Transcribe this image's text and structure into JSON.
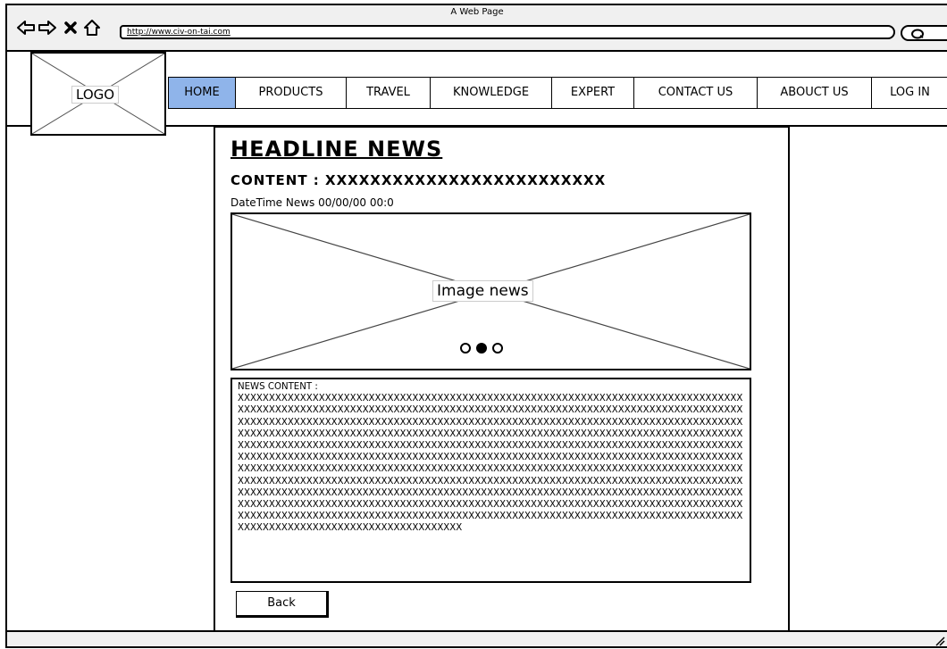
{
  "window": {
    "title": "A Web Page",
    "url": "http://www.civ-on-tai.com"
  },
  "header": {
    "logo_label": "LOGO",
    "nav": [
      {
        "label": "HOME",
        "active": true
      },
      {
        "label": "PRODUCTS"
      },
      {
        "label": "TRAVEL"
      },
      {
        "label": "KNOWLEDGE"
      },
      {
        "label": "EXPERT"
      },
      {
        "label": "CONTACT US"
      },
      {
        "label": "ABOUCT US"
      },
      {
        "label": "LOG IN"
      }
    ]
  },
  "article": {
    "headline": "HEADLINE NEWS",
    "content": "CONTENT : XXXXXXXXXXXXXXXXXXXXXXXXX",
    "datetime": "DateTime News  00/00/00  00:0",
    "image_label": "Image news",
    "carousel_dots": 3,
    "carousel_active": 1,
    "news_label": "NEWS CONTENT :",
    "news_body": "XXXXXXXXXXXXXXXXXXXXXXXXXXXXXXXXXXXXXXXXXXXXXXXXXXXXXXXXXXXXXXXXXXXXXXXXXXXXXXXXXXXXXXXXXXXXXXXXXXXXXXXXXXXXXXXXXXXXXXXXXXXXXXXXXXXXXXXXXXXXXXXXXXXXXXXXXXXXXXXXXXXXXXXXXXXXXXXXXXXXXXXXXXXXXXXXXXXXXXXXXXXXXXXXXXXXXXXXXXXXXXXXXXXXXXXXXXXXXXXXXXXXXXXXXXXXXXXXXXXXXXXXXXXXXXXXXXXXXXXXXXXXXXXXXXXXXXXXXXXXXXXXXXXXXXXXXXXXXXXXXXXXXXXXXXXXXXXXXXXXXXXXXXXXXXXXXXXXXXXXXXXXXXXXXXXXXXXXXXXXXXXXXXXXXXXXXXXXXXXXXXXXXXXXXXXXXXXXXXXXXXXXXXXXXXXXXXXXXXXXXXXXXXXXXXXXXXXXXXXXXXXXXXXXXXXXXXXXXXXXXXXXXXXXXXXXXXXXXXXXXXXXXXXXXXXXXXXXXXXXXXXXXXXXXXXXXXXXXXXXXXXXXXXXXXXXXXXXXXXXXXXXXXXXXXXXXXXXXXXXXXXXXXXXXXXXXXXXXXXXXXXXXXXXXXXXXXXXXXXXXXXXXXXXXXXXXXXXXXXXXXXXXXXXXXXXXXXXXXXXXXXXXXXXXXXXXXXXXXXXXXXXXXXXXXXXXXXXXXXXXXXXXXXXXXXXXXXXXXXXXXXXXXXXXXXXXXXXXXXXXXXXXXXXXXXXXXXXXXXXXXXXXXXXXXXXXXXXXXXXXXXXXXXXXXXXXXXXXXXXXXXXXXXXXXXXXXXXXXXXXXXXXXXXXXXXXXXXXXXXXXXXXXXXXXXXXXXXXXXXXXXXXXXXXXXXXXXXXXXXXXXXXXXXXXXXXXXXXXXXXXXXXXXXXXXXXXXXXXXXXXXXXXX",
    "back_label": "Back"
  }
}
